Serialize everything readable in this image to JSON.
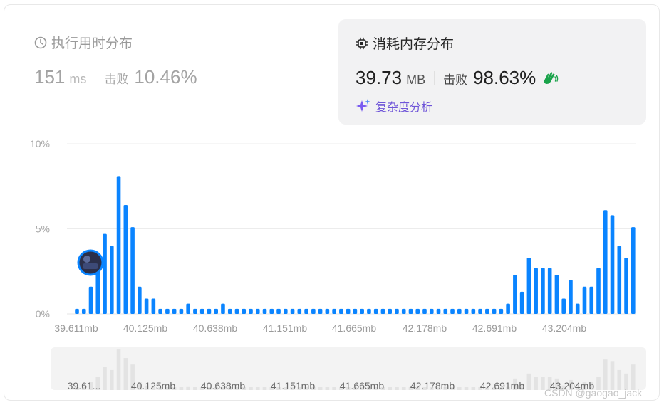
{
  "runtime": {
    "title": "执行用时分布",
    "value": "151",
    "unit": "ms",
    "beat_label": "击败",
    "beat_value": "10.46%"
  },
  "memory": {
    "title": "消耗内存分布",
    "value": "39.73",
    "unit": "MB",
    "beat_label": "击败",
    "beat_value": "98.63%",
    "analysis_label": "复杂度分析"
  },
  "colors": {
    "bar": "#0a84ff",
    "accent_purple": "#6f55d8",
    "mini_bar": "#e3e3e3"
  },
  "chart_data": {
    "type": "bar",
    "ylim": [
      0,
      10
    ],
    "y_ticks": [
      "10%",
      "5%",
      "0%"
    ],
    "x_tick_labels": [
      "39.611mb",
      "40.125mb",
      "40.638mb",
      "41.151mb",
      "41.665mb",
      "42.178mb",
      "42.691mb",
      "43.204mb"
    ],
    "mini_tick_labels": [
      "39.61...",
      "40.125mb",
      "40.638mb",
      "41.151mb",
      "41.665mb",
      "42.178mb",
      "42.691mb",
      "43.204mb"
    ],
    "values": [
      0.3,
      0.3,
      1.6,
      2.6,
      4.7,
      4.0,
      8.1,
      6.4,
      5.1,
      1.6,
      0.9,
      0.9,
      0.3,
      0.3,
      0.3,
      0.3,
      0.6,
      0.3,
      0.3,
      0.3,
      0.3,
      0.6,
      0.3,
      0.3,
      0.3,
      0.3,
      0.3,
      0.3,
      0.3,
      0.3,
      0.3,
      0.3,
      0.3,
      0.3,
      0.3,
      0.3,
      0.3,
      0.3,
      0.3,
      0.3,
      0.3,
      0.3,
      0.3,
      0.3,
      0.3,
      0.3,
      0.3,
      0.3,
      0.3,
      0.3,
      0.3,
      0.3,
      0.3,
      0.3,
      0.3,
      0.3,
      0.3,
      0.3,
      0.3,
      0.3,
      0.3,
      0.3,
      0.6,
      2.3,
      1.3,
      3.3,
      2.7,
      2.7,
      2.7,
      2.3,
      0.9,
      2.0,
      0.6,
      1.6,
      1.6,
      2.7,
      6.1,
      5.8,
      4.0,
      3.3,
      5.1
    ],
    "highlight_index": 3
  },
  "watermark": "CSDN @gaogao_jack"
}
